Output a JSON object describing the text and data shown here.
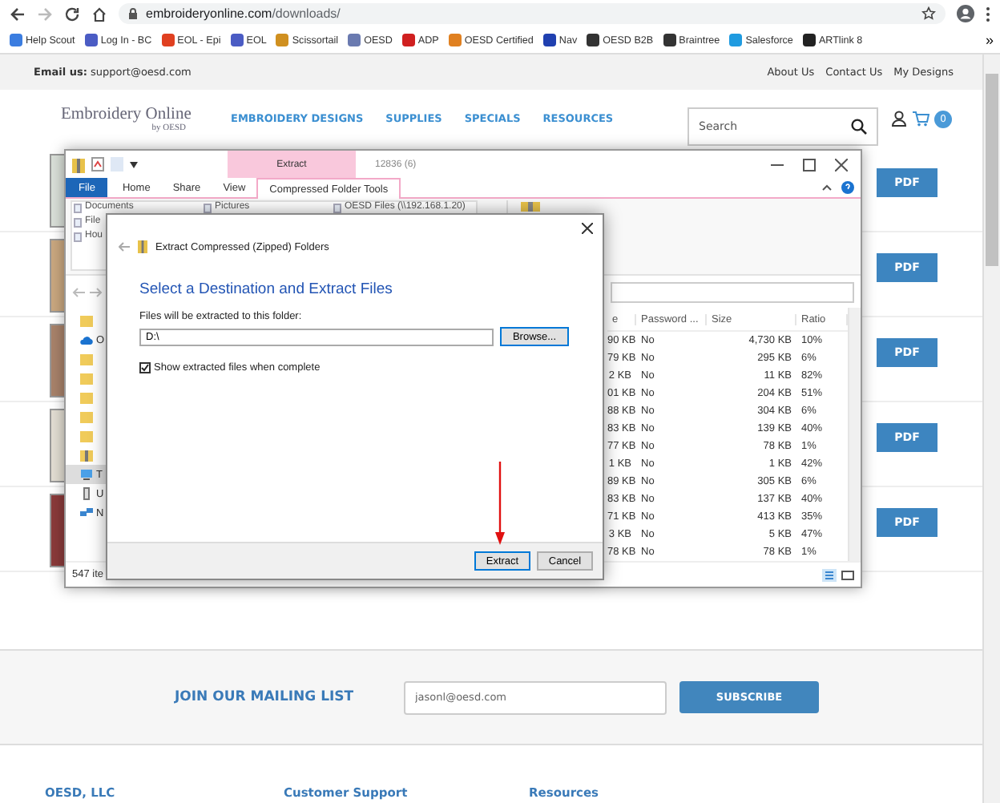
{
  "browser": {
    "url_host": "embroideryonline.com",
    "url_path": "/downloads/",
    "bookmarks": [
      {
        "label": "Help Scout"
      },
      {
        "label": "Log In - BC"
      },
      {
        "label": "EOL - Epi"
      },
      {
        "label": "EOL"
      },
      {
        "label": "Scissortail"
      },
      {
        "label": "OESD"
      },
      {
        "label": "ADP"
      },
      {
        "label": "OESD Certified"
      },
      {
        "label": "Nav"
      },
      {
        "label": "OESD B2B"
      },
      {
        "label": "Braintree"
      },
      {
        "label": "Salesforce"
      },
      {
        "label": "ARTlink 8"
      }
    ],
    "more": "»"
  },
  "site": {
    "topbar": {
      "email_label": "Email us:",
      "email": "support@oesd.com",
      "links": [
        "About Us",
        "Contact Us",
        "My Designs"
      ]
    },
    "logo": {
      "title": "Embroidery Online",
      "byline": "by OESD"
    },
    "nav": [
      "EMBROIDERY DESIGNS",
      "SUPPLIES",
      "SPECIALS",
      "RESOURCES"
    ],
    "search": {
      "placeholder": "Search"
    },
    "cart_count": "0",
    "downloads": [
      {
        "button": "PDF"
      },
      {
        "button": "PDF"
      },
      {
        "button": "PDF"
      },
      {
        "button": "PDF"
      },
      {
        "button": "PDF"
      }
    ],
    "mailing": {
      "heading": "JOIN OUR MAILING LIST",
      "email": "jasonl@oesd.com",
      "button": "SUBSCRIBE"
    },
    "footer_columns": [
      "OESD, LLC",
      "Customer Support",
      "Resources"
    ]
  },
  "explorer": {
    "context_tab": "Extract",
    "title": "12836 (6)",
    "tabs": [
      {
        "label": "File",
        "kind": "menu",
        "selected": false
      },
      {
        "label": "Home",
        "kind": "tab",
        "selected": false
      },
      {
        "label": "Share",
        "kind": "tab",
        "selected": false
      },
      {
        "label": "View",
        "kind": "tab",
        "selected": false
      },
      {
        "label": "Compressed Folder Tools",
        "kind": "tab",
        "selected": true
      }
    ],
    "quick_access": [
      [
        "Documents",
        "Pictures",
        "OESD Files (\\\\192.168.1.20)"
      ],
      [
        "File"
      ],
      [
        "Hou"
      ]
    ],
    "nav_pane": [
      {
        "kind": "folder"
      },
      {
        "kind": "cloud",
        "label": "O"
      },
      {
        "kind": "folder"
      },
      {
        "kind": "folder"
      },
      {
        "kind": "folder"
      },
      {
        "kind": "folder"
      },
      {
        "kind": "folder"
      },
      {
        "kind": "zip"
      },
      {
        "kind": "pc",
        "label": "T"
      },
      {
        "kind": "usb",
        "label": "U"
      },
      {
        "kind": "network",
        "label": "N"
      }
    ],
    "columns": [
      "e",
      "Password ...",
      "Size",
      "Ratio"
    ],
    "rows": [
      [
        "90 KB",
        "No",
        "4,730 KB",
        "10%"
      ],
      [
        "79 KB",
        "No",
        "295 KB",
        "6%"
      ],
      [
        "2 KB",
        "No",
        "11 KB",
        "82%"
      ],
      [
        "01 KB",
        "No",
        "204 KB",
        "51%"
      ],
      [
        "88 KB",
        "No",
        "304 KB",
        "6%"
      ],
      [
        "83 KB",
        "No",
        "139 KB",
        "40%"
      ],
      [
        "77 KB",
        "No",
        "78 KB",
        "1%"
      ],
      [
        "1 KB",
        "No",
        "1 KB",
        "42%"
      ],
      [
        "89 KB",
        "No",
        "305 KB",
        "6%"
      ],
      [
        "83 KB",
        "No",
        "137 KB",
        "40%"
      ],
      [
        "71 KB",
        "No",
        "413 KB",
        "35%"
      ],
      [
        "3 KB",
        "No",
        "5 KB",
        "47%"
      ],
      [
        "78 KB",
        "No",
        "78 KB",
        "1%"
      ]
    ],
    "status": "547 ite"
  },
  "dialog": {
    "title": "Extract Compressed (Zipped) Folders",
    "heading": "Select a Destination and Extract Files",
    "folder_label": "Files will be extracted to this folder:",
    "folder_value": "D:\\",
    "browse": "Browse...",
    "show_files": {
      "label": "Show extracted files when complete",
      "checked": true
    },
    "buttons": [
      "Extract",
      "Cancel"
    ]
  }
}
